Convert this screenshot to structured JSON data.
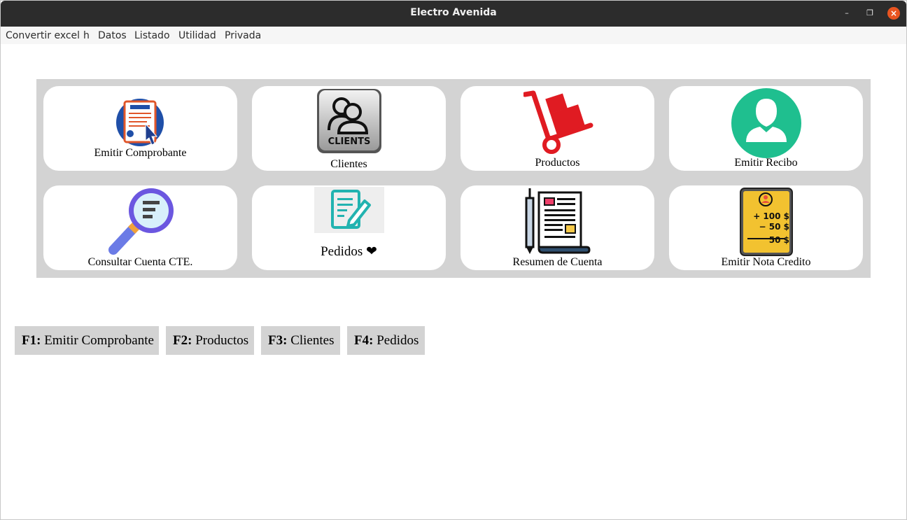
{
  "window": {
    "title": "Electro Avenida"
  },
  "menu": [
    "Convertir excel",
    "h",
    "Datos",
    "Listado",
    "Utilidad",
    "Privada"
  ],
  "tiles": [
    {
      "label": "Emitir Comprobante",
      "icon": "invoice-icon"
    },
    {
      "label": "Clientes",
      "icon": "clients-icon",
      "icon_text": "CLIENTS"
    },
    {
      "label": "Productos",
      "icon": "hand-truck-icon"
    },
    {
      "label": "Emitir Recibo",
      "icon": "user-avatar-icon"
    },
    {
      "label": "Consultar Cuenta CTE.",
      "icon": "magnifier-icon"
    },
    {
      "label": "Pedidos ❤",
      "icon": "notepad-pen-icon"
    },
    {
      "label": "Resumen de Cuenta",
      "icon": "newspaper-pen-icon"
    },
    {
      "label": "Emitir Nota Credito",
      "icon": "credit-note-icon",
      "icon_lines": [
        "+ 100 $",
        "− 50 $",
        "50 $"
      ]
    }
  ],
  "shortcuts": [
    {
      "key": "F1:",
      "label": "Emitir Comprobante"
    },
    {
      "key": "F2:",
      "label": "Productos"
    },
    {
      "key": "F3:",
      "label": "Clientes"
    },
    {
      "key": "F4:",
      "label": "Pedidos"
    }
  ],
  "colors": {
    "titlebar": "#2c2c2c",
    "close_button": "#e95420",
    "panel": "#d3d3d3",
    "recibo_green": "#1fbf8f",
    "productos_red": "#e01b22"
  }
}
